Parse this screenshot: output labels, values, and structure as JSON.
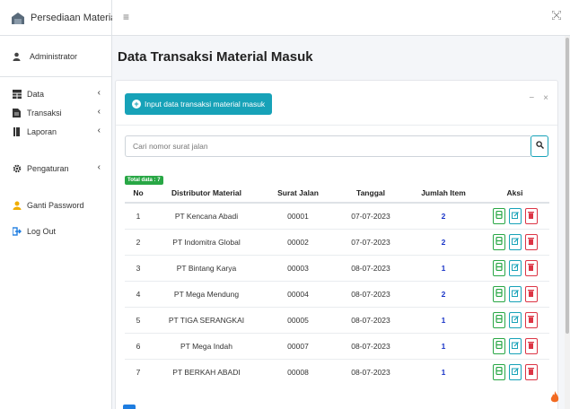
{
  "app": {
    "brand": "Persediaan Material"
  },
  "user": {
    "name": "Administrator"
  },
  "sidebar": {
    "items": [
      {
        "label": "Data",
        "has_children": true
      },
      {
        "label": "Transaksi",
        "has_children": true
      },
      {
        "label": "Laporan",
        "has_children": true
      },
      {
        "label": "Pengaturan",
        "has_children": true
      },
      {
        "label": "Ganti Password",
        "has_children": false
      },
      {
        "label": "Log Out",
        "has_children": false
      }
    ],
    "chevron": "‹"
  },
  "topbar": {
    "menu_icon": "≡",
    "fullscreen_icon": "⛶"
  },
  "page": {
    "title": "Data Transaksi Material Masuk"
  },
  "card": {
    "input_button_label": "Input data transaksi material masuk",
    "collapse_icon": "−",
    "close_icon": "×"
  },
  "search": {
    "placeholder": "Cari nomor surat jalan",
    "value": ""
  },
  "badge": {
    "total_label": "Total data : 7"
  },
  "table": {
    "headers": [
      "No",
      "Distributor Material",
      "Surat Jalan",
      "Tanggal",
      "Jumlah Item",
      "Aksi"
    ],
    "rows": [
      {
        "no": "1",
        "distributor": "PT Kencana Abadi",
        "surat_jalan": "00001",
        "tanggal": "07-07-2023",
        "jumlah": "2"
      },
      {
        "no": "2",
        "distributor": "PT Indomitra Global",
        "surat_jalan": "00002",
        "tanggal": "07-07-2023",
        "jumlah": "2"
      },
      {
        "no": "3",
        "distributor": "PT Bintang Karya",
        "surat_jalan": "00003",
        "tanggal": "08-07-2023",
        "jumlah": "1"
      },
      {
        "no": "4",
        "distributor": "PT Mega Mendung",
        "surat_jalan": "00004",
        "tanggal": "08-07-2023",
        "jumlah": "2"
      },
      {
        "no": "5",
        "distributor": "PT TIGA SERANGKAI",
        "surat_jalan": "00005",
        "tanggal": "08-07-2023",
        "jumlah": "1"
      },
      {
        "no": "6",
        "distributor": "PT Mega Indah",
        "surat_jalan": "00007",
        "tanggal": "08-07-2023",
        "jumlah": "1"
      },
      {
        "no": "7",
        "distributor": "PT BERKAH ABADI",
        "surat_jalan": "00008",
        "tanggal": "08-07-2023",
        "jumlah": "1"
      }
    ]
  },
  "colors": {
    "accent": "#17a2b8",
    "success": "#28a745",
    "danger": "#dc3545",
    "count": "#1a35c8"
  },
  "icons": {
    "brand": "warehouse-icon",
    "user": "user-icon",
    "data": "table-icon",
    "transaksi": "file-icon",
    "laporan": "book-icon",
    "pengaturan": "gear-icon",
    "ganti_password": "user-key-icon",
    "logout": "logout-icon",
    "search": "search-icon",
    "detail": "print-icon",
    "edit": "edit-icon",
    "delete": "trash-icon"
  }
}
